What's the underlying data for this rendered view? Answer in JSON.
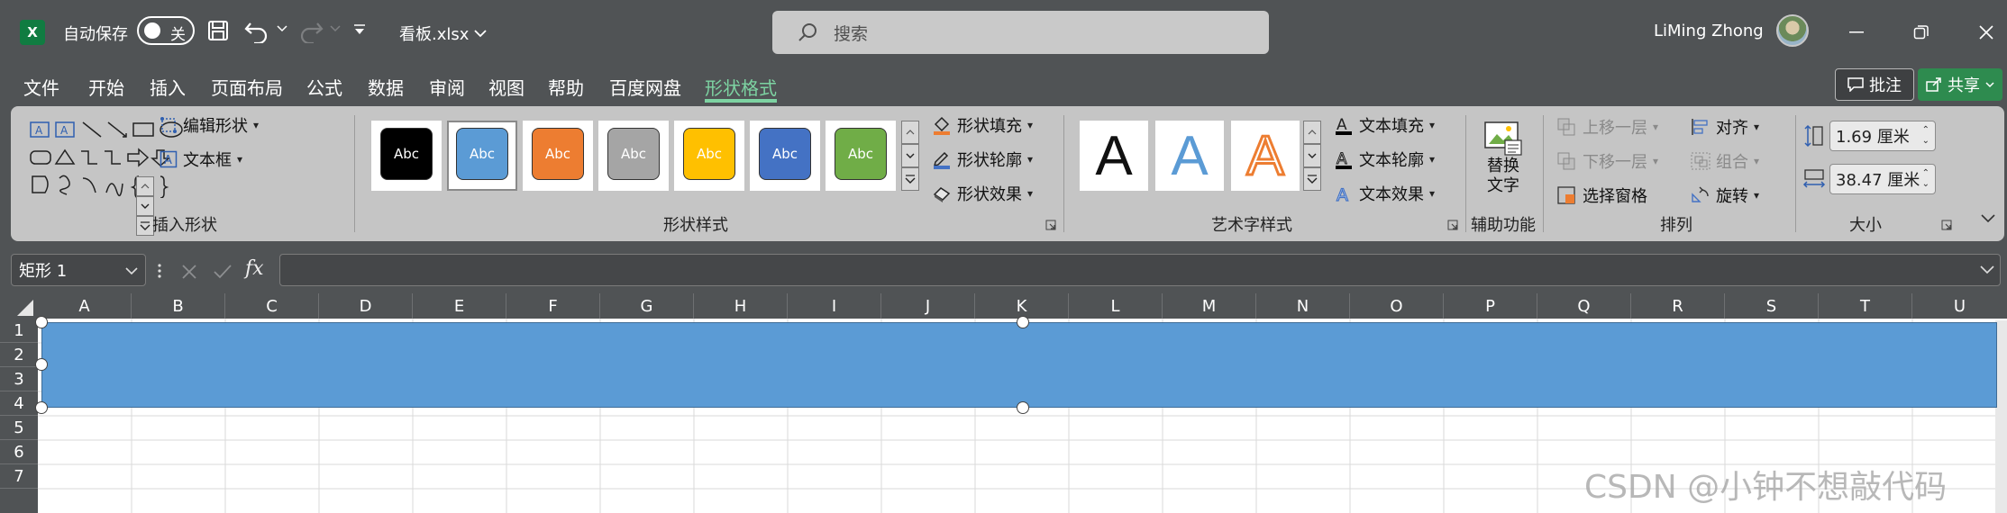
{
  "titlebar": {
    "app_icon_letter": "X",
    "autosave_label": "自动保存",
    "autosave_state": "关",
    "filename": "看板.xlsx",
    "search_placeholder": "搜索",
    "username": "LiMing Zhong"
  },
  "menu": {
    "items": [
      "文件",
      "开始",
      "插入",
      "页面布局",
      "公式",
      "数据",
      "审阅",
      "视图",
      "帮助",
      "百度网盘",
      "形状格式"
    ],
    "active": "形状格式",
    "comment_label": "批注",
    "share_label": "共享"
  },
  "ribbon": {
    "insert_shapes": {
      "label": "插入形状",
      "edit_shape": "编辑形状",
      "text_box": "文本框"
    },
    "shape_styles": {
      "label": "形状样式",
      "thumb_text": "Abc",
      "fill": "形状填充",
      "outline": "形状轮廓",
      "effects": "形状效果",
      "colors": [
        "#000000",
        "#5b9bd5",
        "#ed7d31",
        "#a5a5a5",
        "#ffc000",
        "#4472c4",
        "#70ad47"
      ]
    },
    "wordart": {
      "label": "艺术字样式",
      "letter": "A",
      "text_fill": "文本填充",
      "text_outline": "文本轮廓",
      "text_effects": "文本效果"
    },
    "accessibility": {
      "label": "辅助功能",
      "alt_text_line1": "替换",
      "alt_text_line2": "文字"
    },
    "arrange": {
      "label": "排列",
      "bring_forward": "上移一层",
      "send_backward": "下移一层",
      "selection_pane": "选择窗格",
      "align": "对齐",
      "group": "组合",
      "rotate": "旋转"
    },
    "size": {
      "label": "大小",
      "height": "1.69 厘米",
      "width": "38.47 厘米"
    }
  },
  "formula_bar": {
    "name_box": "矩形 1",
    "fx": "fx",
    "formula": ""
  },
  "sheet": {
    "columns": [
      "A",
      "B",
      "C",
      "D",
      "E",
      "F",
      "G",
      "H",
      "I",
      "J",
      "K",
      "L",
      "M",
      "N",
      "O",
      "P",
      "Q",
      "R",
      "S",
      "T",
      "U"
    ],
    "rows": [
      "1",
      "2",
      "3",
      "4",
      "5",
      "6",
      "7"
    ],
    "shape_color": "#5b9bd5"
  },
  "watermark": "CSDN @小钟不想敲代码"
}
